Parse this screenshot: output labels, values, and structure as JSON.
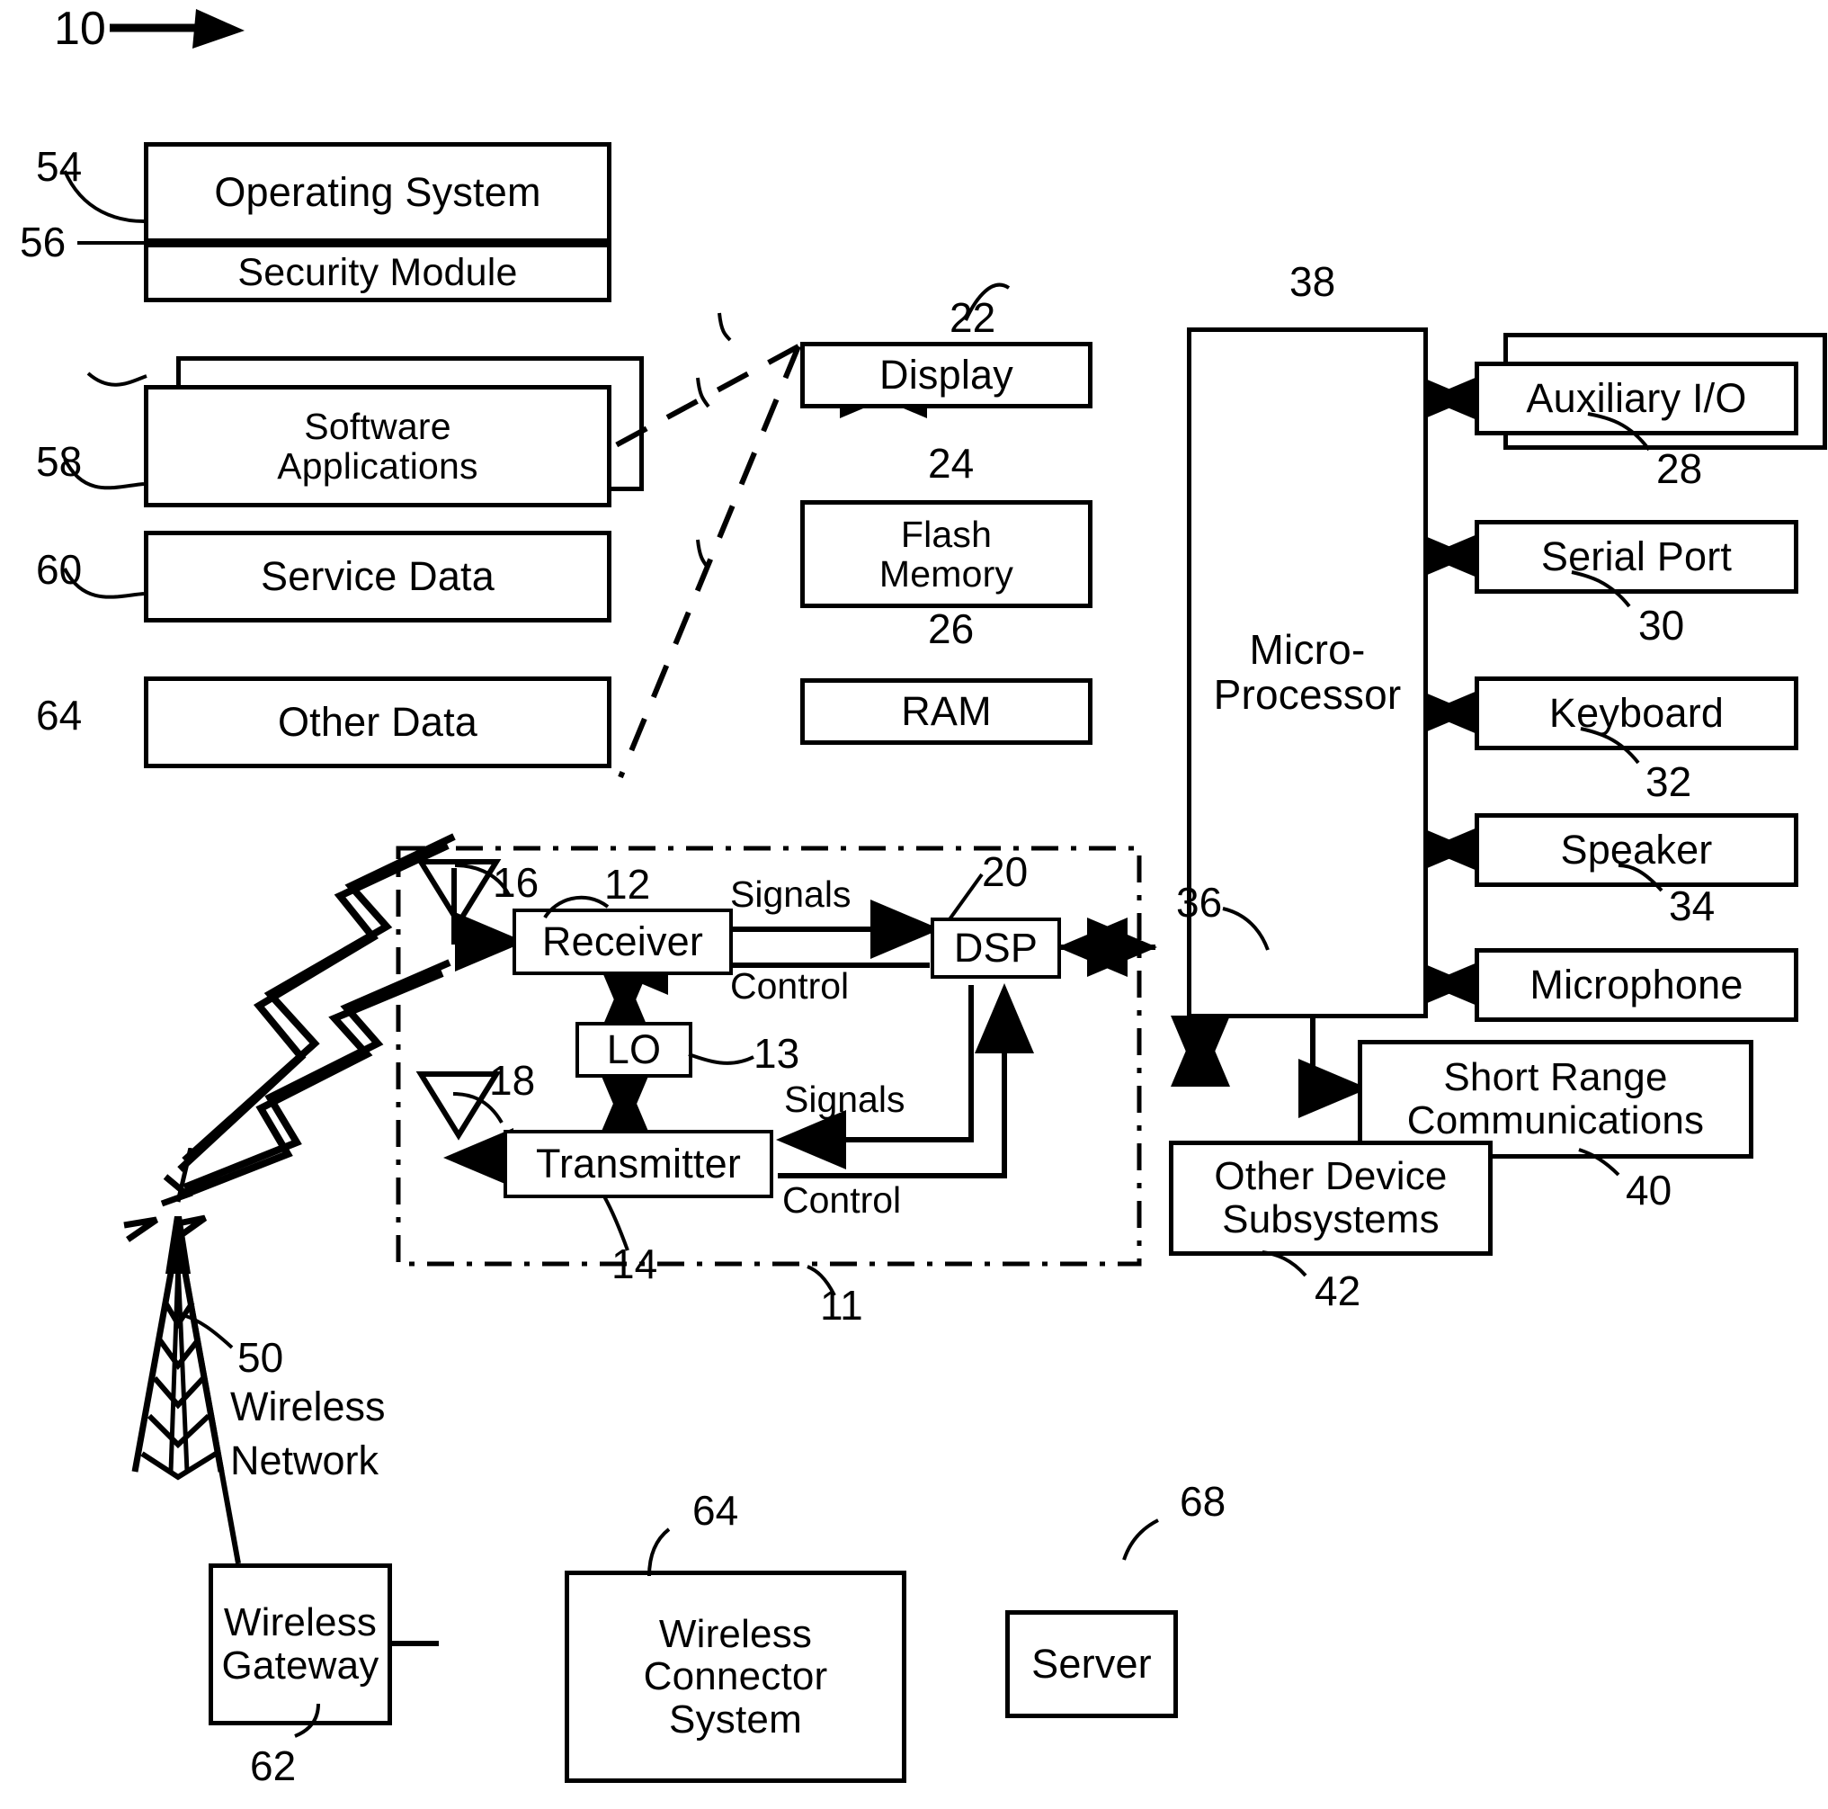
{
  "figure": {
    "label": "10",
    "kind": "patent-block-diagram",
    "title_arrow": "arrow-pointing-right"
  },
  "memory_blocks": [
    {
      "id": "operating-system",
      "label": "Operating System",
      "numeral": "54"
    },
    {
      "id": "security-module",
      "label": "Security Module",
      "numeral": "56"
    },
    {
      "id": "software-applications",
      "label": "Software\nApplications",
      "line1": "Software",
      "line2": "Applications",
      "numeral": "58",
      "stacked": true
    },
    {
      "id": "service-data",
      "label": "Service Data",
      "numeral": "60"
    },
    {
      "id": "other-data",
      "label": "Other Data",
      "numeral": "64"
    }
  ],
  "core_blocks": [
    {
      "id": "display",
      "label": "Display",
      "numeral": "22"
    },
    {
      "id": "flash-memory",
      "line1": "Flash",
      "line2": "Memory",
      "label": "Flash Memory",
      "numeral": "24"
    },
    {
      "id": "ram",
      "label": "RAM",
      "numeral": "26"
    },
    {
      "id": "microprocessor",
      "line1": "Micro-",
      "line2": "Processor",
      "label": "Micro-Processor",
      "numeral": "38"
    }
  ],
  "peripheral_blocks": [
    {
      "id": "auxiliary-io",
      "label": "Auxiliary I/O",
      "numeral": "28",
      "stacked": true
    },
    {
      "id": "serial-port",
      "label": "Serial Port",
      "numeral": "30"
    },
    {
      "id": "keyboard",
      "label": "Keyboard",
      "numeral": "32"
    },
    {
      "id": "speaker",
      "label": "Speaker",
      "numeral": "34"
    },
    {
      "id": "microphone",
      "label": "Microphone",
      "numeral": "36"
    },
    {
      "id": "short-range-communications",
      "line1": "Short Range",
      "line2": "Communications",
      "label": "Short Range Communications",
      "numeral": "40"
    },
    {
      "id": "other-device-subsystems",
      "line1": "Other Device",
      "line2": "Subsystems",
      "label": "Other Device Subsystems",
      "numeral": "42"
    }
  ],
  "radio_subsystem": {
    "numeral": "11",
    "blocks": [
      {
        "id": "receiver",
        "label": "Receiver",
        "numeral": "12"
      },
      {
        "id": "lo",
        "label": "LO",
        "numeral": "13"
      },
      {
        "id": "transmitter",
        "label": "Transmitter",
        "numeral": "14"
      },
      {
        "id": "dsp",
        "label": "DSP",
        "numeral": "20"
      }
    ],
    "antennas": [
      {
        "id": "receive-antenna",
        "numeral": "16"
      },
      {
        "id": "transmit-antenna",
        "numeral": "18"
      }
    ],
    "link_labels": {
      "signals_top": "Signals",
      "control_top": "Control",
      "signals_bottom": "Signals",
      "control_bottom": "Control"
    }
  },
  "network": {
    "tower": {
      "id": "wireless-network-tower",
      "numeral": "50",
      "line1": "Wireless",
      "line2": "Network",
      "label": "Wireless Network"
    },
    "blocks": [
      {
        "id": "wireless-gateway",
        "line1": "Wireless",
        "line2": "Gateway",
        "label": "Wireless Gateway",
        "numeral": "62"
      },
      {
        "id": "wireless-connector-system",
        "line1": "Wireless",
        "line2": "Connector",
        "line3": "System",
        "label": "Wireless Connector System",
        "numeral": "64"
      },
      {
        "id": "server",
        "label": "Server",
        "numeral": "68"
      }
    ]
  },
  "colors": {
    "ink": "#000000",
    "paper": "#ffffff"
  }
}
